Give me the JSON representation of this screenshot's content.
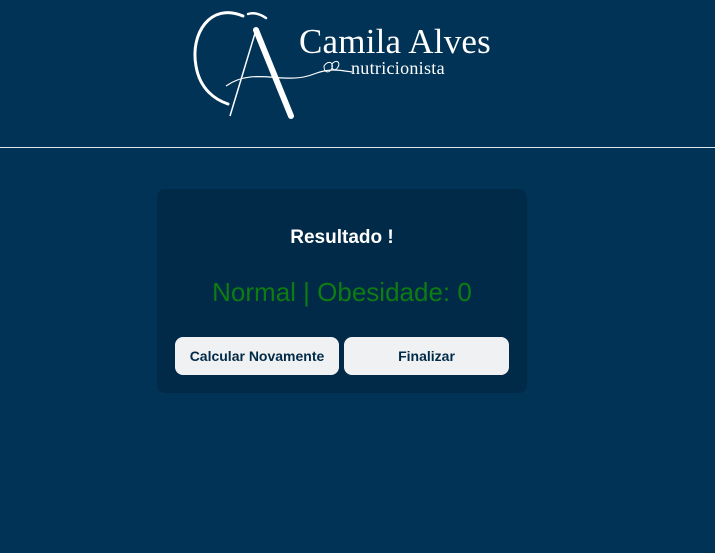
{
  "header": {
    "logo": {
      "monogram": "CA",
      "name": "Camila Alves",
      "tagline": "nutricionista"
    }
  },
  "result_card": {
    "title": "Resultado !",
    "result": "Normal | Obesidade: 0",
    "buttons": {
      "recalculate_label": "Calcular Novamente",
      "finish_label": "Finalizar"
    }
  },
  "colors": {
    "background": "#003356",
    "card": "#002a47",
    "result_text": "#0d7c12",
    "button_bg": "#f0f1f3"
  }
}
